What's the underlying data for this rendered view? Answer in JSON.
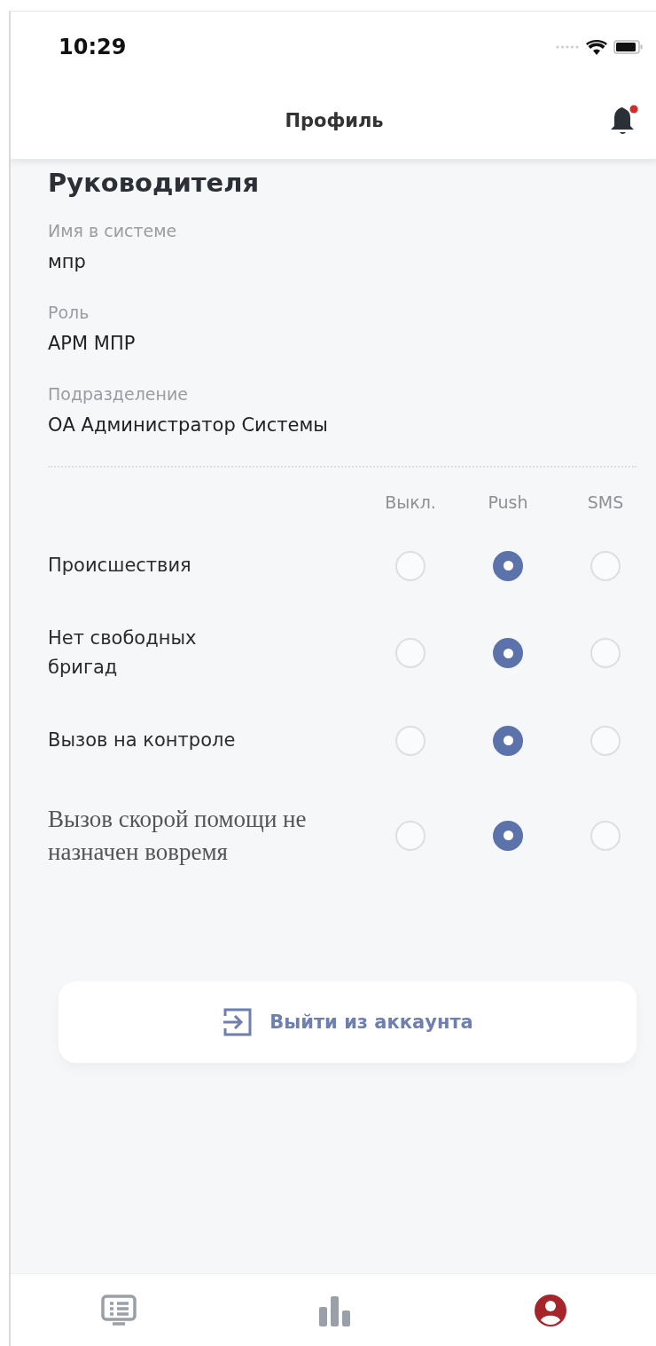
{
  "status_bar": {
    "time": "10:29"
  },
  "header": {
    "title": "Профиль",
    "notification_unread": true
  },
  "profile": {
    "heading": "Руководителя",
    "fields": [
      {
        "label": "Имя в системе",
        "value": "мпр"
      },
      {
        "label": "Роль",
        "value": "АРМ МПР"
      },
      {
        "label": "Подразделение",
        "value": "ОА Администратор Системы"
      }
    ]
  },
  "notifications": {
    "columns": [
      "Выкл.",
      "Push",
      "SMS"
    ],
    "rows": [
      {
        "kind": "plain",
        "label": "Происшествия",
        "options": [
          {
            "selected": false
          },
          {
            "selected": true
          },
          {
            "selected": false
          }
        ]
      },
      {
        "kind": "plain",
        "label": "Нет свободных бригад",
        "options": [
          {
            "selected": false
          },
          {
            "selected": true
          },
          {
            "selected": false
          }
        ]
      },
      {
        "kind": "plain",
        "label": "Вызов на контроле",
        "options": [
          {
            "selected": false
          },
          {
            "selected": true
          },
          {
            "selected": false
          }
        ]
      },
      {
        "kind": "serif",
        "label": "Вызов скорой помощи не назначен вовремя",
        "options": [
          {
            "selected": false
          },
          {
            "selected": true
          },
          {
            "selected": false
          }
        ]
      }
    ]
  },
  "logout_button": {
    "label": "Выйти из аккаунта"
  },
  "tab_bar": [
    {
      "kind": "list",
      "selected": false
    },
    {
      "kind": "stats",
      "selected": false
    },
    {
      "kind": "profile",
      "selected": true
    }
  ]
}
